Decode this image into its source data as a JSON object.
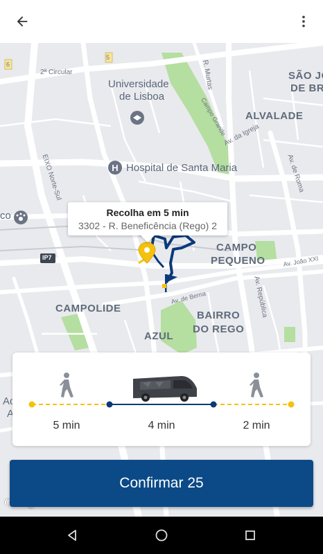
{
  "appbar": {
    "back_icon": "arrow-back-icon",
    "menu_icon": "more-vert-icon"
  },
  "map": {
    "labels": {
      "segunda_circular": "2ª Circular",
      "universidade": "Universidade\nde Lisboa",
      "universidade_l1": "Universidade",
      "universidade_l2": "de Lisboa",
      "r_murtas": "R. Murtas",
      "sao_joao_l1": "SÃO JO",
      "sao_joao_l2": "DE BRI",
      "alvalade": "ALVALADE",
      "campo_grande": "Campo Grande",
      "av_da_igreja": "Av. da Igreja",
      "hospital": "Hospital de Santa Maria",
      "av_de_roma": "Av. de Roma",
      "eixo_norte_sul": "EIXO Norte-Sul",
      "zoo_fragment": "co",
      "campo_pequeno_l1": "CAMPO",
      "campo_pequeno_l2": "PEQUENO",
      "av_joao_xxi": "Av. João XXI",
      "ip7": "IP7",
      "av_republica": "Av. República",
      "av_de_berna": "Av. de Berna",
      "campolide": "CAMPOLIDE",
      "bairro_l1": "BAIRRO",
      "bairro_l2": "DO REGO",
      "azul": "AZUL",
      "road_5": "5",
      "road_6": "6",
      "left_a": "Ac",
      "left_a2": "A",
      "google": "Google"
    },
    "route_color": "#0b3a7a",
    "pickup_color": "#f4c20d"
  },
  "tooltip": {
    "title": "Recolha em 5 min",
    "subtitle": "3302 - R. Beneficência (Rego) 2"
  },
  "journey": {
    "segments": [
      {
        "mode": "walk",
        "icon": "walking-person-icon",
        "duration": "5 min"
      },
      {
        "mode": "van",
        "icon": "van-icon",
        "duration": "4 min"
      },
      {
        "mode": "walk",
        "icon": "walking-person-icon",
        "duration": "2 min"
      }
    ],
    "walk_line_color": "#f4c20d",
    "van_line_color": "#0b3a7a"
  },
  "confirm_button": {
    "label": "Confirmar 25",
    "color": "#0b4a87"
  },
  "navbar": {
    "back": "nav-back-icon",
    "home": "nav-home-icon",
    "recents": "nav-recents-icon"
  }
}
